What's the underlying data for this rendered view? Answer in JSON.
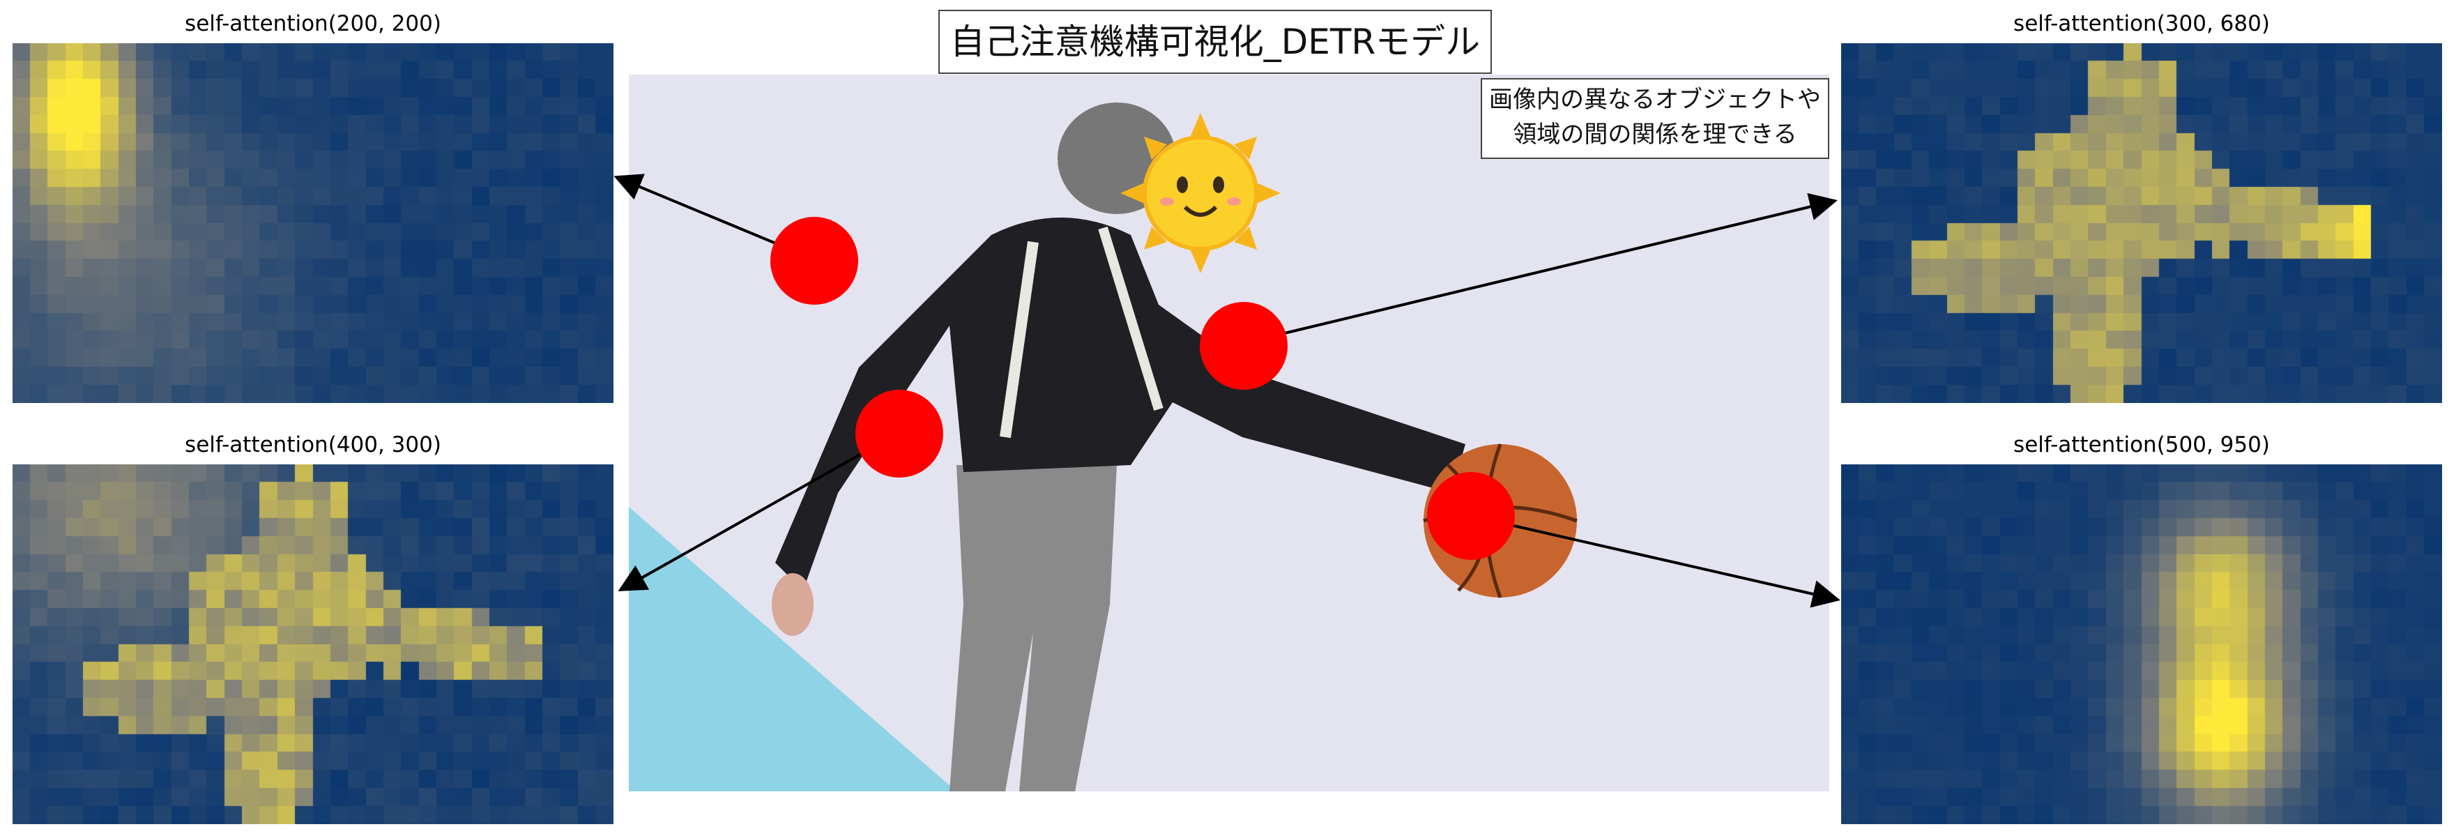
{
  "main_title": "自己注意機構可視化_DETRモデル",
  "note": {
    "line1": "画像内の異なるオブジェクトや",
    "line2": "領域の間の関係を理できる"
  },
  "panels": [
    {
      "title": "self-attention(200, 200)",
      "focus": "background-upper-left"
    },
    {
      "title": "self-attention(300, 680)",
      "focus": "person"
    },
    {
      "title": "self-attention(400, 300)",
      "focus": "person-and-left"
    },
    {
      "title": "self-attention(500, 950)",
      "focus": "basketball"
    }
  ],
  "query_point_color": "#ff0000",
  "colormap": {
    "low": "#00306e",
    "mid": "#7f7f7a",
    "high": "#fee83a"
  },
  "photo": {
    "background": "#e6e6f2",
    "floor_color": "#8fd3e6",
    "ball_color": "#c8652f",
    "face_icon": "sun-emoji-icon"
  }
}
